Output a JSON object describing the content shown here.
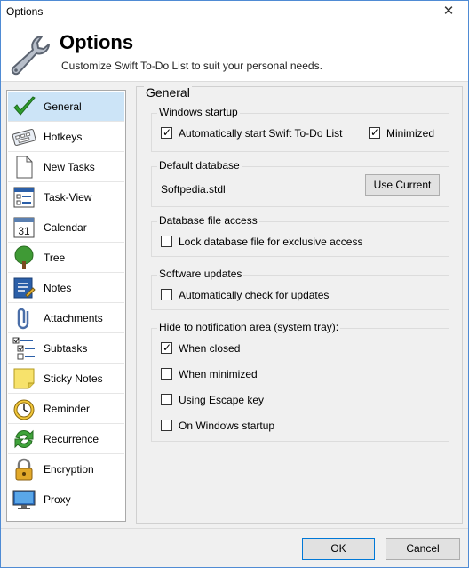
{
  "window": {
    "title": "Options",
    "close_glyph": "✕"
  },
  "header": {
    "title": "Options",
    "subtitle": "Customize Swift To-Do List to suit your personal needs.",
    "icon": "wrench-icon"
  },
  "sidebar": {
    "items": [
      {
        "label": "General",
        "icon": "checkmark-icon",
        "selected": true
      },
      {
        "label": "Hotkeys",
        "icon": "keyboard-icon",
        "selected": false
      },
      {
        "label": "New Tasks",
        "icon": "new-document-icon",
        "selected": false
      },
      {
        "label": "Task-View",
        "icon": "task-list-icon",
        "selected": false
      },
      {
        "label": "Calendar",
        "icon": "calendar-icon",
        "selected": false,
        "badge": "31"
      },
      {
        "label": "Tree",
        "icon": "tree-icon",
        "selected": false
      },
      {
        "label": "Notes",
        "icon": "notes-icon",
        "selected": false
      },
      {
        "label": "Attachments",
        "icon": "paperclip-icon",
        "selected": false
      },
      {
        "label": "Subtasks",
        "icon": "subtasks-icon",
        "selected": false
      },
      {
        "label": "Sticky Notes",
        "icon": "sticky-note-icon",
        "selected": false
      },
      {
        "label": "Reminder",
        "icon": "alarm-clock-icon",
        "selected": false
      },
      {
        "label": "Recurrence",
        "icon": "recurrence-icon",
        "selected": false
      },
      {
        "label": "Encryption",
        "icon": "padlock-icon",
        "selected": false
      },
      {
        "label": "Proxy",
        "icon": "monitor-icon",
        "selected": false
      }
    ]
  },
  "panel": {
    "title": "General",
    "windows_startup": {
      "title": "Windows startup",
      "auto_start_label": "Automatically start Swift To-Do List",
      "auto_start_checked": true,
      "minimized_label": "Minimized",
      "minimized_checked": true
    },
    "default_database": {
      "title": "Default database",
      "value": "Softpedia.stdl",
      "use_current_label": "Use Current"
    },
    "database_access": {
      "title": "Database file access",
      "lock_label": "Lock database file for exclusive access",
      "lock_checked": false
    },
    "software_updates": {
      "title": "Software updates",
      "check_label": "Automatically check for updates",
      "check_checked": false
    },
    "tray": {
      "title": "Hide to notification area (system tray):",
      "options": [
        {
          "label": "When closed",
          "checked": true
        },
        {
          "label": "When minimized",
          "checked": false
        },
        {
          "label": "Using Escape key",
          "checked": false
        },
        {
          "label": "On Windows startup",
          "checked": false
        }
      ]
    }
  },
  "footer": {
    "ok_label": "OK",
    "cancel_label": "Cancel"
  }
}
